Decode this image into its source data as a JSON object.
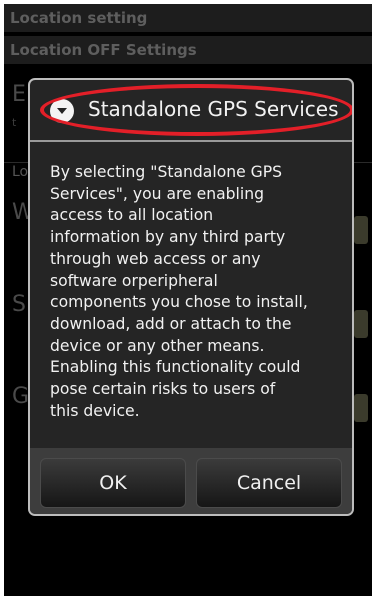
{
  "background_screen": {
    "header_title": "Location setting",
    "section_title": "Location OFF Settings",
    "item_letters": [
      "E",
      "Lo",
      "W",
      "S",
      "G"
    ]
  },
  "dialog": {
    "title": "Standalone GPS Services",
    "title_icon": "chevron-down-circle-icon",
    "message": "By selecting \"Standalone GPS\nServices\", you are enabling\naccess to all location\ninformation by any third party\nthrough web access or any\nsoftware orperipheral\ncomponents you chose to install,\ndownload, add or attach to the\ndevice or any other means.\nEnabling this functionality could\npose certain risks to users of\nthis device.",
    "buttons": {
      "ok_label": "OK",
      "cancel_label": "Cancel"
    }
  },
  "colors": {
    "highlight_ring": "#e31f28",
    "dialog_background": "#252525"
  }
}
